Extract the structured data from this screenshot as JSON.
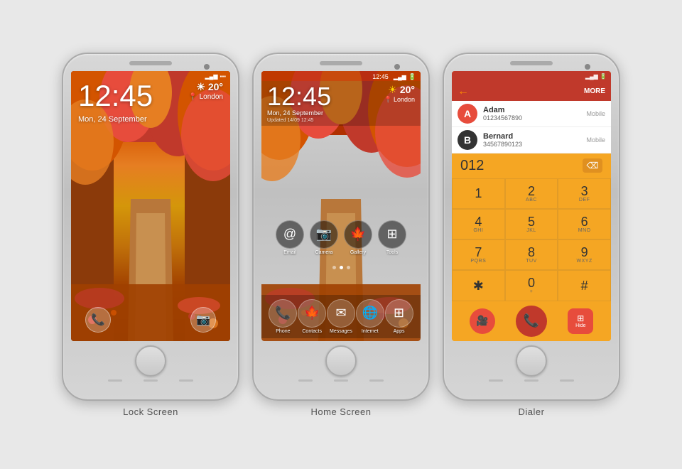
{
  "phones": [
    {
      "id": "lockscreen",
      "label": "Lock Screen",
      "time": "12:45",
      "date": "Mon, 24 September",
      "weather_temp": "20°",
      "weather_location": "London",
      "weather_icon": "☀",
      "status_signal": "▂▄▆",
      "status_battery": "🔋"
    },
    {
      "id": "homescreen",
      "label": "Home Screen",
      "time": "12:45",
      "date": "Mon, 24 September",
      "updated": "Updated 14/09 12:45",
      "weather_temp": "20°",
      "weather_location": "London",
      "weather_icon": "☀",
      "status_signal": "▂▄▆",
      "status_battery": "🔋",
      "apps": [
        {
          "icon": "@",
          "label": "Email"
        },
        {
          "icon": "📷",
          "label": "Camera"
        },
        {
          "icon": "🍁",
          "label": "Gallery"
        },
        {
          "icon": "🔧",
          "label": "Tools"
        }
      ],
      "dock": [
        {
          "icon": "📞",
          "label": "Phone"
        },
        {
          "icon": "🍁",
          "label": "Contacts"
        },
        {
          "icon": "✉",
          "label": "Messages"
        },
        {
          "icon": "🌐",
          "label": "Internet"
        },
        {
          "icon": "⊞",
          "label": "Apps"
        }
      ]
    },
    {
      "id": "dialer",
      "label": "Dialer",
      "more_label": "MORE",
      "number_display": "012",
      "contacts": [
        {
          "initial": "A",
          "name": "Adam",
          "number": "01234567890",
          "type": "Mobile",
          "color": "#e74c3c"
        },
        {
          "initial": "B",
          "name": "Bernard",
          "number": "34567890123",
          "type": "Mobile",
          "color": "#333"
        }
      ],
      "keypad": [
        {
          "digit": "1",
          "alpha": ""
        },
        {
          "digit": "2",
          "alpha": "ABC"
        },
        {
          "digit": "3",
          "alpha": "DEF"
        },
        {
          "digit": "4",
          "alpha": "GHI"
        },
        {
          "digit": "5",
          "alpha": "JKL"
        },
        {
          "digit": "6",
          "alpha": "MNO"
        },
        {
          "digit": "7",
          "alpha": "PQRS"
        },
        {
          "digit": "8",
          "alpha": "TUV"
        },
        {
          "digit": "9",
          "alpha": "WXYZ"
        },
        {
          "digit": "✱",
          "alpha": ""
        },
        {
          "digit": "0",
          "alpha": "+"
        },
        {
          "digit": "#",
          "alpha": ""
        }
      ]
    }
  ]
}
